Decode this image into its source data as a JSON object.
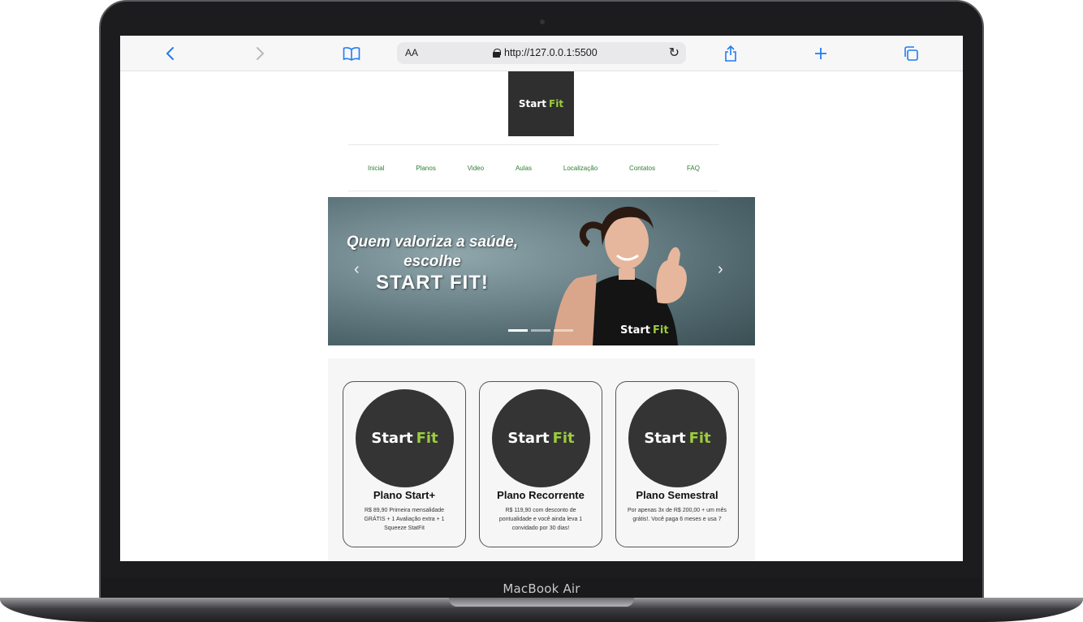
{
  "browser": {
    "text_size_label": "AA",
    "url": "http://127.0.0.1:5500"
  },
  "device": {
    "label": "MacBook Air"
  },
  "site": {
    "brand_start": "Start",
    "brand_fit": "Fit",
    "brand_color": "#9ccc3c",
    "nav": [
      {
        "label": "Inicial"
      },
      {
        "label": "Planos"
      },
      {
        "label": "Video"
      },
      {
        "label": "Aulas"
      },
      {
        "label": "Localização"
      },
      {
        "label": "Contatos"
      },
      {
        "label": "FAQ"
      }
    ],
    "hero": {
      "line1": "Quem valoriza a saúde,",
      "line2": "escolhe",
      "line3": "START FIT!"
    },
    "plans": [
      {
        "title": "Plano Start+",
        "description": "R$ 89,90 Primeira mensalidade GRÁTIS + 1 Avaliação extra + 1 Squeeze StatFit"
      },
      {
        "title": "Plano Recorrente",
        "description": "R$ 119,90 com desconto de pontualidade e você ainda leva 1 convidado por 30 dias!"
      },
      {
        "title": "Plano Semestral",
        "description": "Por apenas 3x de R$ 200,00 + um mês grátis!. Você paga 6 meses e usa 7"
      }
    ]
  }
}
